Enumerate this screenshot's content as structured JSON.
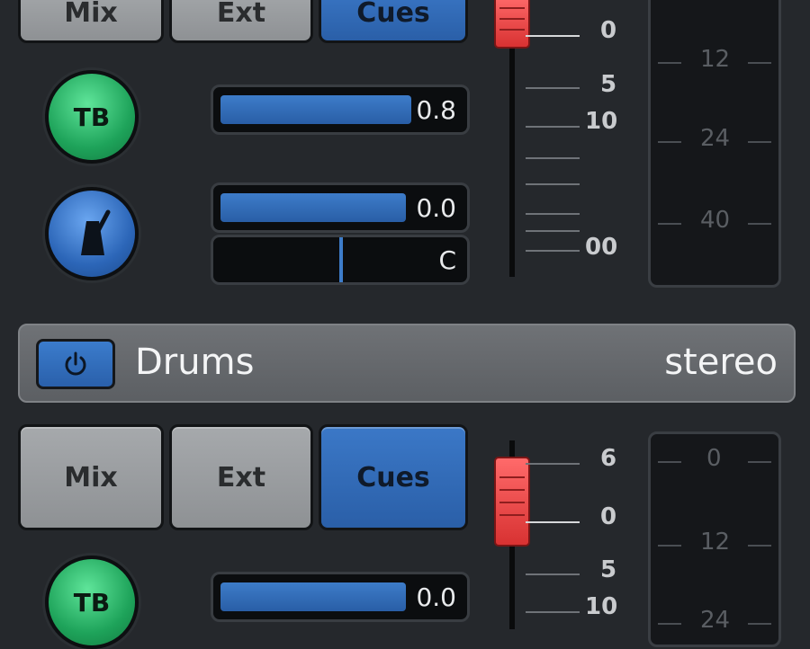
{
  "top_strip": {
    "sources": [
      "Mix",
      "Ext",
      "Cues"
    ],
    "active_source": "Cues",
    "talkback_label": "TB",
    "talkback_level": "0.8",
    "click_level": "0.0",
    "click_pan": "C",
    "fader_scale": [
      "0",
      "5",
      "10",
      "00"
    ],
    "meter_scale": [
      "12",
      "24",
      "40"
    ]
  },
  "channel": {
    "name": "Drums",
    "type": "stereo"
  },
  "bottom_strip": {
    "sources": [
      "Mix",
      "Ext",
      "Cues"
    ],
    "active_source": "Cues",
    "talkback_label": "TB",
    "talkback_level": "0.0",
    "fader_scale": [
      "6",
      "0",
      "5",
      "10"
    ],
    "meter_scale": [
      "0",
      "12",
      "24"
    ]
  },
  "colors": {
    "background": "#25282c",
    "active_blue": "#2f6bb8",
    "talkback_green": "#1ea35a",
    "fader_red": "#e03c3c"
  },
  "icons": [
    "metronome-icon",
    "power-icon"
  ]
}
